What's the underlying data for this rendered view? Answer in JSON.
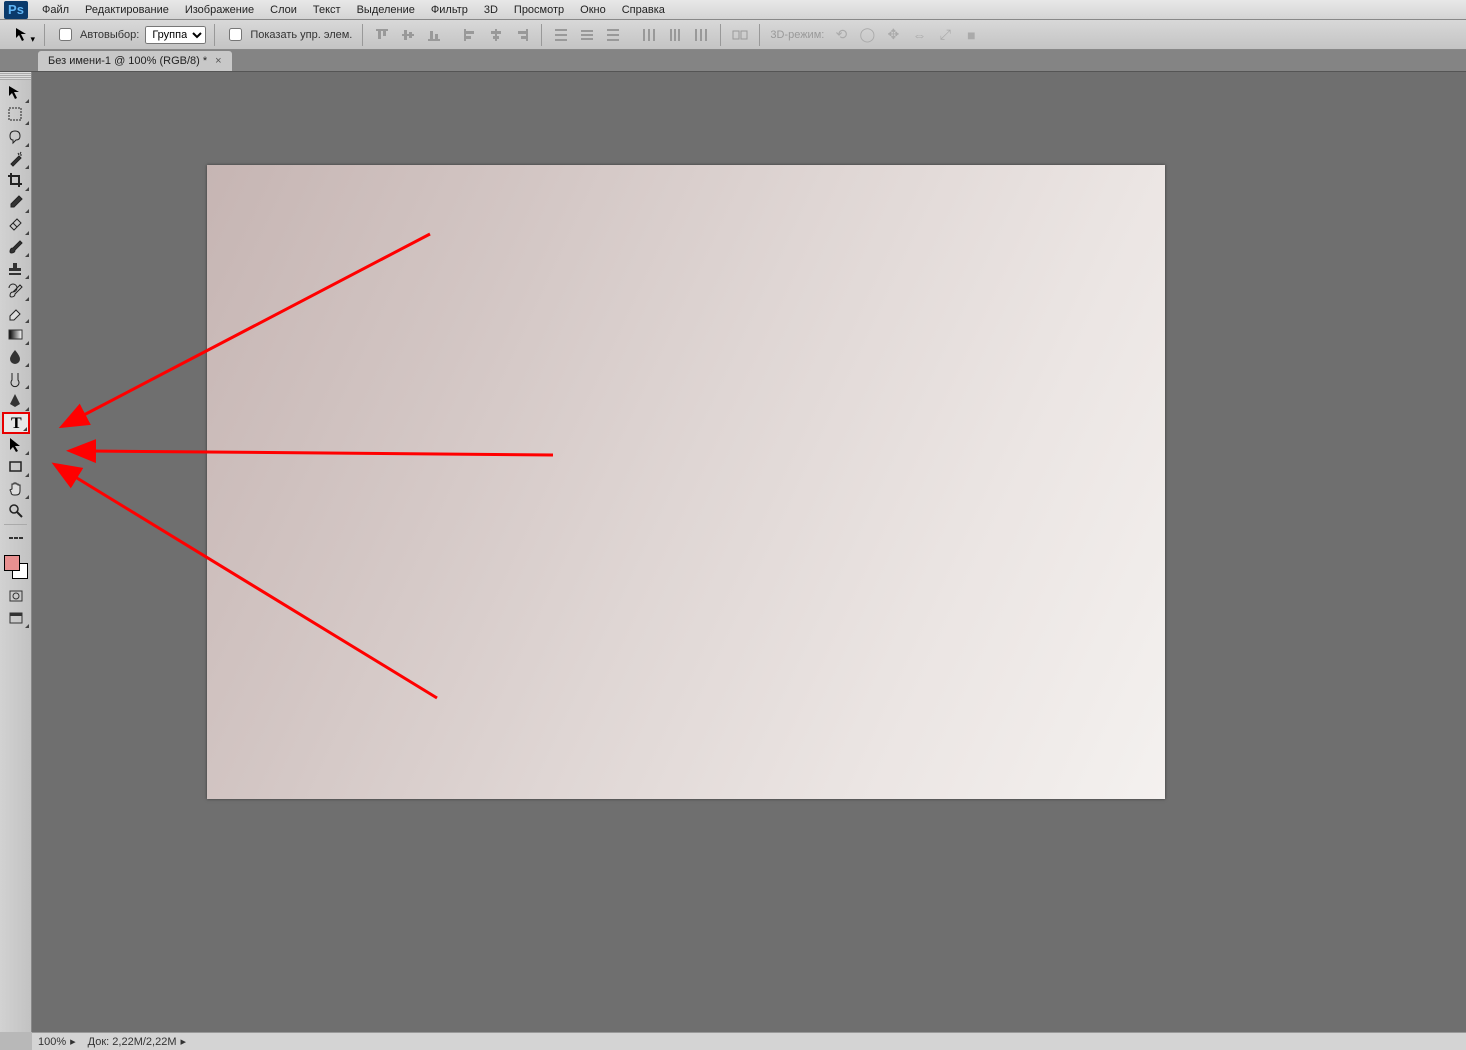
{
  "app": {
    "logo": "Ps"
  },
  "menu": [
    "Файл",
    "Редактирование",
    "Изображение",
    "Слои",
    "Текст",
    "Выделение",
    "Фильтр",
    "3D",
    "Просмотр",
    "Окно",
    "Справка"
  ],
  "options": {
    "auto_select_label": "Автовыбор:",
    "group_select": "Группа",
    "show_transform_label": "Показать упр. элем.",
    "mode3d_label": "3D-режим:"
  },
  "tab": {
    "title": "Без имени-1 @ 100% (RGB/8) *",
    "close": "×"
  },
  "tools": [
    {
      "name": "move-tool",
      "glyph": "move",
      "sub": true
    },
    {
      "name": "marquee-tool",
      "glyph": "marquee",
      "sub": true
    },
    {
      "name": "lasso-tool",
      "glyph": "lasso",
      "sub": true
    },
    {
      "name": "magic-wand-tool",
      "glyph": "wand",
      "sub": true
    },
    {
      "name": "crop-tool",
      "glyph": "crop",
      "sub": true
    },
    {
      "name": "eyedropper-tool",
      "glyph": "eyedropper",
      "sub": true
    },
    {
      "name": "healing-brush-tool",
      "glyph": "bandage",
      "sub": true
    },
    {
      "name": "brush-tool",
      "glyph": "brush",
      "sub": true
    },
    {
      "name": "stamp-tool",
      "glyph": "stamp",
      "sub": true
    },
    {
      "name": "history-brush-tool",
      "glyph": "historybrush",
      "sub": true
    },
    {
      "name": "eraser-tool",
      "glyph": "eraser",
      "sub": true
    },
    {
      "name": "gradient-tool",
      "glyph": "gradient",
      "sub": true
    },
    {
      "name": "blur-tool",
      "glyph": "blur",
      "sub": true
    },
    {
      "name": "dodge-tool",
      "glyph": "dodge",
      "sub": true
    },
    {
      "name": "pen-tool",
      "glyph": "pen",
      "sub": true
    },
    {
      "name": "type-tool",
      "glyph": "type",
      "sub": true,
      "highlight": true
    },
    {
      "name": "path-selection-tool",
      "glyph": "pathsel",
      "sub": true
    },
    {
      "name": "rectangle-tool",
      "glyph": "rect",
      "sub": true
    },
    {
      "name": "hand-tool",
      "glyph": "hand",
      "sub": true
    },
    {
      "name": "zoom-tool",
      "glyph": "zoom",
      "sub": false
    }
  ],
  "colors": {
    "fg": "#e89090",
    "bg": "#ffffff"
  },
  "status": {
    "zoom": "100%",
    "doc": "Док: 2,22M/2,22M"
  }
}
